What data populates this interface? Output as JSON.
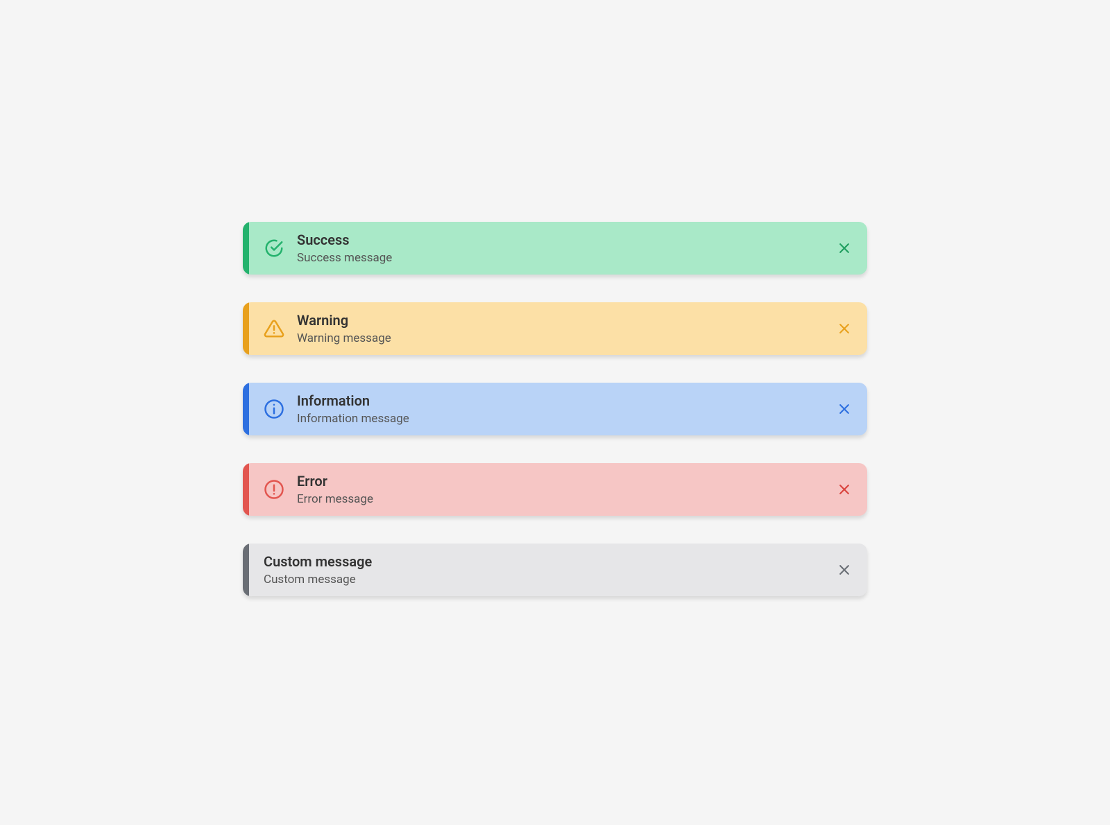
{
  "alerts": {
    "success": {
      "title": "Success",
      "message": "Success message"
    },
    "warning": {
      "title": "Warning",
      "message": "Warning message"
    },
    "info": {
      "title": "Information",
      "message": "Information message"
    },
    "error": {
      "title": "Error",
      "message": "Error message"
    },
    "custom": {
      "title": "Custom message",
      "message": "Custom message"
    }
  }
}
